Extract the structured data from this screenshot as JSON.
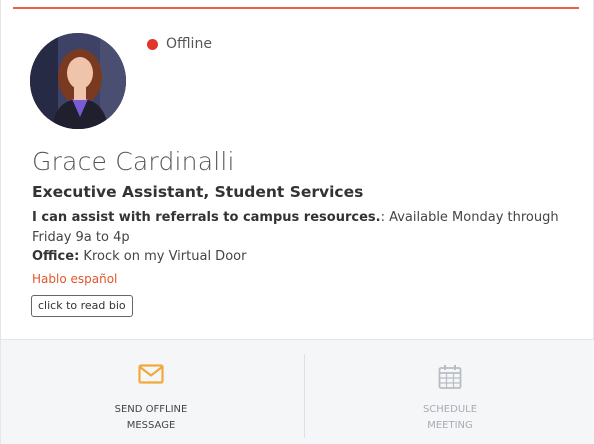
{
  "status": {
    "text": "Offline",
    "color": "#e0352b"
  },
  "profile": {
    "name": "Grace Cardinalli",
    "title": "Executive Assistant, Student Services",
    "assist_label": "I can assist with referrals to campus resources.",
    "assist_colon": ":",
    "assist_text": " Available Monday through Friday 9a to 4p",
    "office_label": "Office:",
    "office_text": " Krock on my Virtual Door",
    "language": "Hablo español",
    "language_color": "#e0562e",
    "bio_button": "click to read bio"
  },
  "actions": {
    "send": {
      "label": "SEND OFFLINE\nMESSAGE",
      "icon": "envelope-icon",
      "icon_color": "#f2a93b"
    },
    "schedule": {
      "label": "SCHEDULE\nMEETING",
      "icon": "calendar-icon",
      "icon_color": "#b8bdc3"
    }
  },
  "colors": {
    "accent_rule": "#e8604c"
  }
}
